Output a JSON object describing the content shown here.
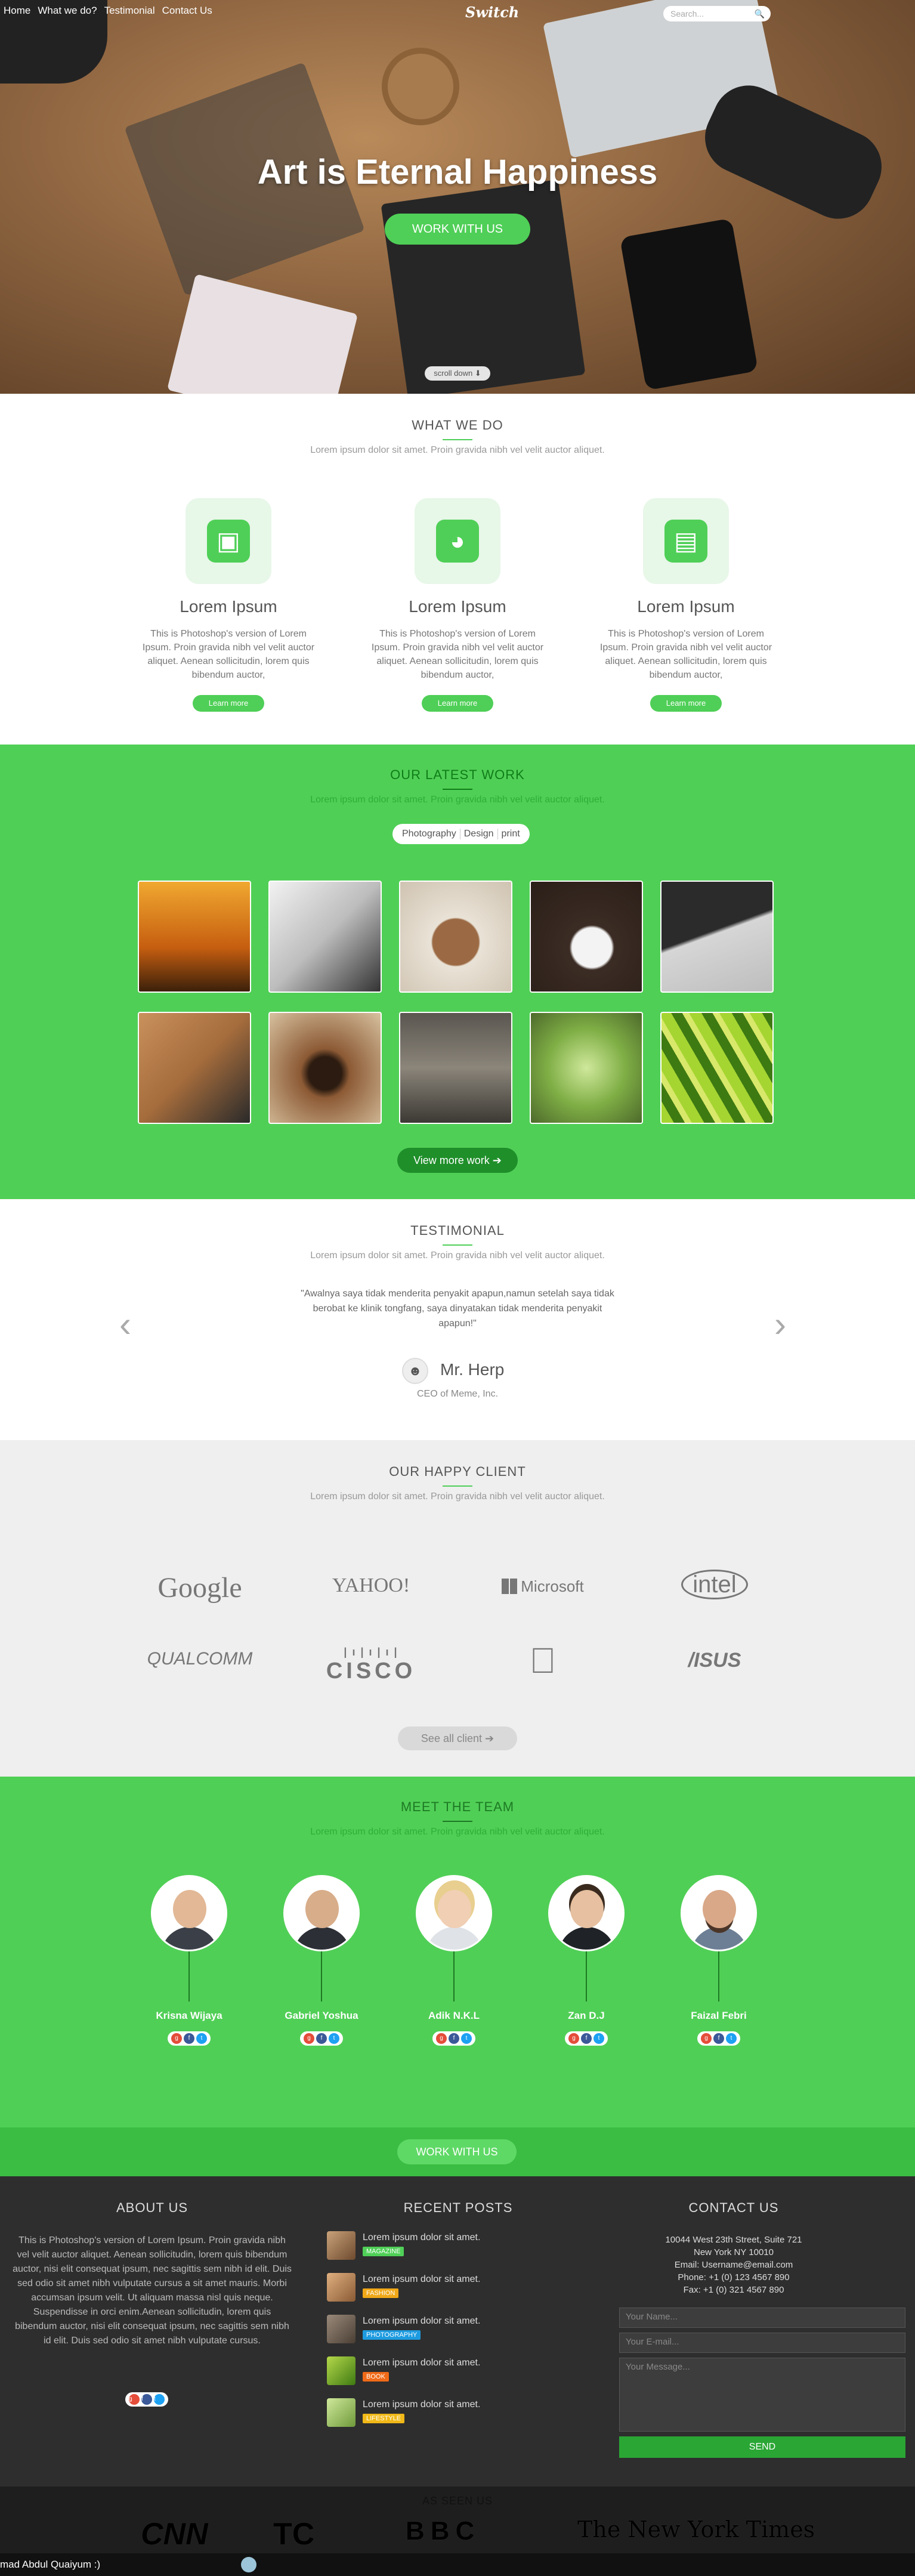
{
  "nav": {
    "items": [
      "Home",
      "What we do?",
      "Testimonial",
      "Contact Us"
    ],
    "logo": "Switch",
    "search_placeholder": "Search..."
  },
  "hero": {
    "title": "Art is Eternal Happiness",
    "cta": "WORK WITH US",
    "scroll": "scroll down ⬇"
  },
  "what": {
    "title": "WHAT WE DO",
    "subtitle": "Lorem ipsum dolor sit amet. Proin gravida nibh vel velit auctor aliquet.",
    "features": [
      {
        "icon": "camera-icon",
        "title": "Lorem Ipsum",
        "text": "This is Photoshop's version of Lorem Ipsum. Proin gravida nibh vel velit auctor aliquet. Aenean sollicitudin, lorem quis bibendum auctor,",
        "btn": "Learn more"
      },
      {
        "icon": "dashboard-icon",
        "title": "Lorem Ipsum",
        "text": "This is Photoshop's version of Lorem Ipsum. Proin gravida nibh vel velit auctor aliquet. Aenean sollicitudin, lorem quis bibendum auctor,",
        "btn": "Learn more"
      },
      {
        "icon": "briefcase-icon",
        "title": "Lorem Ipsum",
        "text": "This is Photoshop's version of Lorem Ipsum. Proin gravida nibh vel velit auctor aliquet. Aenean sollicitudin, lorem quis bibendum auctor,",
        "btn": "Learn more"
      }
    ]
  },
  "work": {
    "title": "OUR LATEST WORK",
    "subtitle": "Lorem ipsum dolor sit amet. Proin gravida nibh vel velit auctor aliquet.",
    "filters": [
      "Photography",
      "Design",
      "print"
    ],
    "more": "View more work ➔"
  },
  "testimonial": {
    "title": "TESTIMONIAL",
    "subtitle": "Lorem ipsum dolor sit amet. Proin gravida nibh vel velit auctor aliquet.",
    "quote": "\"Awalnya saya tidak menderita penyakit apapun,namun setelah saya tidak berobat ke klinik tongfang, saya dinyatakan tidak menderita penyakit apapun!\"",
    "name": "Mr. Herp",
    "role": "CEO of Meme, Inc."
  },
  "clients": {
    "title": "OUR HAPPY CLIENT",
    "subtitle": "Lorem ipsum dolor sit amet. Proin gravida nibh vel velit auctor aliquet.",
    "logos": [
      "Google",
      "YAHOO!",
      "Microsoft",
      "intel",
      "QUALCOMM",
      "CISCO",
      "",
      "/ISUS"
    ],
    "see_all": "See all client ➔"
  },
  "team": {
    "title": "MEET THE TEAM",
    "subtitle": "Lorem ipsum dolor sit amet. Proin gravida nibh vel velit auctor aliquet.",
    "members": [
      "Krisna Wijaya",
      "Gabriel Yoshua",
      "Adik N.K.L",
      "Zan D.J",
      "Faizal Febri"
    ],
    "cta": "WORK WITH US"
  },
  "footer": {
    "about_title": "ABOUT US",
    "about_text": "This is Photoshop's version of Lorem Ipsum. Proin gravida nibh vel velit auctor aliquet. Aenean sollicitudin, lorem quis bibendum auctor, nisi elit consequat ipsum, nec sagittis sem nibh id elit. Duis sed odio sit amet nibh vulputate cursus a sit amet mauris. Morbi accumsan ipsum velit. Ut aliquam massa nisl quis neque. Suspendisse in orci enim.Aenean sollicitudin, lorem quis bibendum auctor, nisi elit consequat ipsum, nec sagittis sem nibh id elit. Duis sed odio sit amet nibh vulputate cursus.",
    "posts_title": "RECENT POSTS",
    "posts": [
      {
        "text": "Lorem ipsum dolor sit amet.",
        "tag": "MAGAZINE",
        "color": "#4fcf57"
      },
      {
        "text": "Lorem ipsum dolor sit amet.",
        "tag": "FASHION",
        "color": "#f0a818"
      },
      {
        "text": "Lorem ipsum dolor sit amet.",
        "tag": "PHOTOGRAPHY",
        "color": "#1e9be0"
      },
      {
        "text": "Lorem ipsum dolor sit amet.",
        "tag": "BOOK",
        "color": "#f06a18"
      },
      {
        "text": "Lorem ipsum dolor sit amet.",
        "tag": "LIFESTYLE",
        "color": "#f0b818"
      }
    ],
    "contact_title": "CONTACT US",
    "address": "10044 West 23th Street, Suite 721 New York NY 10010",
    "email": "Email: Username@email.com",
    "phone": "Phone: +1 (0) 123 4567 890",
    "fax": "Fax: +1 (0) 321 4567 890",
    "name_placeholder": "Your Name...",
    "email_placeholder": "Your E-mail...",
    "message_placeholder": "Your Message...",
    "send": "SEND"
  },
  "seen": {
    "title": "AS SEEN US",
    "logos": [
      "CNN",
      "TC",
      "BBC",
      "The New York Times"
    ]
  },
  "status": {
    "text": "mad Abdul Quaiyum :)"
  }
}
